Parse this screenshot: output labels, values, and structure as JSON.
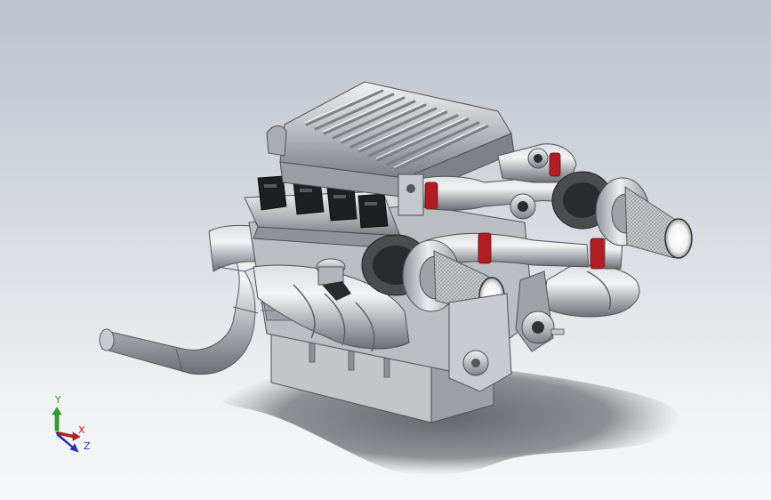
{
  "viewport": {
    "background_top": "#bcc2cb",
    "background_bottom": "#f6f7f8"
  },
  "model": {
    "part_color": "#c9ccd0",
    "coil_color": "#1e1f22",
    "coupler_color": "#b01e24",
    "filter_color": "#d9d9d9"
  },
  "triad": {
    "y_label": "Y",
    "x_label": "X",
    "z_label": "Z",
    "y_color": "#2fa12f",
    "x_color": "#c81e1e",
    "z_color": "#2435c8"
  }
}
